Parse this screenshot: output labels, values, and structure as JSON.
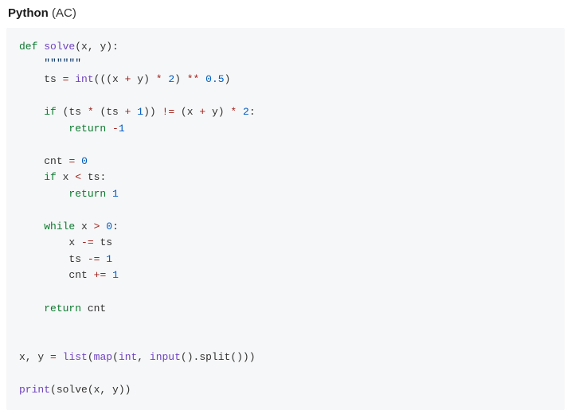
{
  "title": {
    "lang": "Python",
    "status": "(AC)"
  },
  "code": {
    "t01a": "def",
    "t01b": "solve",
    "t01c": "(x, y):",
    "t02": "\"\"\"\"\"\"",
    "t03a": "ts ",
    "t03b": "=",
    "t03c": "int",
    "t03d": "(((x ",
    "t03e": "+",
    "t03f": " y) ",
    "t03g": "*",
    "t03h": "2",
    "t03i": ") ",
    "t03j": "**",
    "t03k": "0.5",
    "t03l": ")",
    "t04a": "if",
    "t04b": " (ts ",
    "t04c": "*",
    "t04d": " (ts ",
    "t04e": "+",
    "t04f": "1",
    "t04g": ")) ",
    "t04h": "!=",
    "t04i": " (x ",
    "t04j": "+",
    "t04k": " y) ",
    "t04l": "*",
    "t04m": "2",
    "t04n": ":",
    "t05a": "return",
    "t05b": "-",
    "t05c": "1",
    "t06a": "cnt ",
    "t06b": "=",
    "t06c": "0",
    "t07a": "if",
    "t07b": " x ",
    "t07c": "<",
    "t07d": " ts:",
    "t08a": "return",
    "t08b": "1",
    "t09a": "while",
    "t09b": " x ",
    "t09c": ">",
    "t09d": "0",
    "t09e": ":",
    "t10a": "x ",
    "t10b": "-=",
    "t10c": " ts",
    "t11a": "ts ",
    "t11b": "-=",
    "t11c": "1",
    "t12a": "cnt ",
    "t12b": "+=",
    "t12c": "1",
    "t13a": "return",
    "t13b": " cnt",
    "t14a": "x, y ",
    "t14b": "=",
    "t14c": "list",
    "t14d": "(",
    "t14e": "map",
    "t14f": "(",
    "t14g": "int",
    "t14h": ", ",
    "t14i": "input",
    "t14j": "().split()))",
    "t15a": "print",
    "t15b": "(solve(x, y))"
  }
}
